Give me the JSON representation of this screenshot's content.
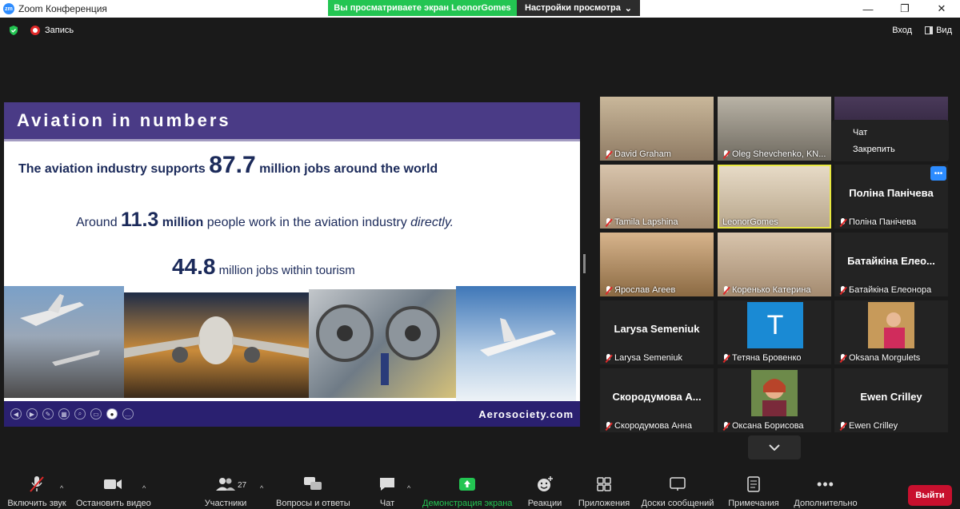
{
  "window": {
    "title": "Zoom Конференция",
    "logo": "zm"
  },
  "share_banner": {
    "viewing": "Вы просматриваете экран LeonorGomes",
    "view_options": "Настройки просмотра"
  },
  "top": {
    "recording": "Запись",
    "enter": "Вход",
    "view": "Вид"
  },
  "slide": {
    "title": "Aviation in numbers",
    "line1_pre": "The aviation industry supports ",
    "line1_big": "87.7",
    "line1_post": " million jobs around the world",
    "line2_pre": "Around ",
    "line2_big": "11.3",
    "line2_mid": " million",
    "line2_post": " people work in the aviation industry ",
    "line2_em": "directly.",
    "line3_big": "44.8",
    "line3_post": " million jobs within tourism",
    "footer": "Aerosociety.com"
  },
  "context_menu": {
    "items": [
      "Чат",
      "Закрепить"
    ]
  },
  "participants": [
    {
      "name": "David Graham",
      "type": "video"
    },
    {
      "name": "Oleg Shevchenko, KN...",
      "type": "video"
    },
    {
      "name": "",
      "type": "video"
    },
    {
      "name": "Tamila Lapshina",
      "type": "video"
    },
    {
      "name": "LeonorGomes",
      "type": "video"
    },
    {
      "name": "Поліна Панічева",
      "display": "Поліна Панічева",
      "type": "name"
    },
    {
      "name": "Ярослав Агеев",
      "type": "video"
    },
    {
      "name": "Коренько Катерина",
      "type": "video"
    },
    {
      "name": "Батайкіна Елеонора",
      "display": "Батайкіна Елео...",
      "type": "name"
    },
    {
      "name": "Larysa Semeniuk",
      "display": "Larysa Semeniuk",
      "type": "name"
    },
    {
      "name": "Тетяна Бровенко",
      "avatar": "T",
      "type": "avatar"
    },
    {
      "name": "Oksana Morgulets",
      "type": "photo"
    },
    {
      "name": "Скородумова Анна",
      "display": "Скородумова А...",
      "type": "name"
    },
    {
      "name": "Оксана Борисова",
      "type": "photo"
    },
    {
      "name": "Ewen Crilley",
      "display": "Ewen Crilley",
      "type": "name"
    }
  ],
  "toolbar": {
    "audio": "Включить звук",
    "video": "Остановить видео",
    "participants": "Участники",
    "participants_count": "27",
    "qa": "Вопросы и ответы",
    "chat": "Чат",
    "share": "Демонстрация экрана",
    "reactions": "Реакции",
    "apps": "Приложения",
    "whiteboards": "Доски сообщений",
    "notes": "Примечания",
    "more": "Дополнительно",
    "leave": "Выйти"
  },
  "colors": {
    "share_green": "#23c552",
    "leave_red": "#c8102e",
    "slide_purple": "#4a3b86",
    "accent_blue": "#2d8cff"
  }
}
